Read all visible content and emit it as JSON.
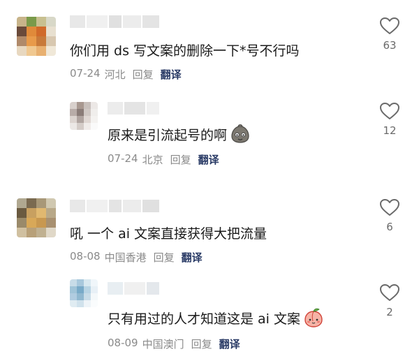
{
  "comments": [
    {
      "text": "你们用 ds 写文案的删除一下*号不行吗",
      "date": "07-24",
      "location": "河北",
      "reply_label": "回复",
      "translate_label": "翻译",
      "likes": "63",
      "avatar_colors": [
        "#c8b48a",
        "#7a9a4a",
        "#c8c090",
        "#d8d8c8",
        "#6a4a3a",
        "#e08a3a",
        "#d06a2a",
        "#e8e0d0",
        "#b08a6a",
        "#e89a4a",
        "#c87a3a",
        "#d8c8b0",
        "#e8d8c0",
        "#f0c890",
        "#e8b070",
        "#f0e8d8"
      ],
      "name_blur": [
        "#e8e8e8",
        "#f0f0f0",
        "#e0e0e0",
        "#ececec",
        "#e4e4e4"
      ]
    },
    {
      "text": "原来是引流起号的啊",
      "emoji": "dirt-face-emoji",
      "date": "07-24",
      "location": "北京",
      "reply_label": "回复",
      "translate_label": "翻译",
      "likes": "12",
      "avatar_colors": [
        "#d8d0cc",
        "#a89890",
        "#c8c0bc",
        "#ece8e6",
        "#b8aca8",
        "#8a7c78",
        "#d0c8c4",
        "#f0eeec",
        "#dcd4d0",
        "#b0a4a0",
        "#e0d8d4",
        "#f4f2f0",
        "#ece8e6",
        "#d4ccc8",
        "#f0ecea",
        "#fafafa"
      ],
      "name_blur": [
        "#ececec",
        "#e4e4e4",
        "#f0f0f0"
      ]
    },
    {
      "text": "吼 一个 ai 文案直接获得大把流量",
      "date": "08-08",
      "location": "中国香港",
      "reply_label": "回复",
      "translate_label": "翻译",
      "likes": "6",
      "avatar_colors": [
        "#b0a890",
        "#7a6a50",
        "#a89878",
        "#d0c8b0",
        "#6a5a40",
        "#c8a060",
        "#e0b870",
        "#b8a888",
        "#9a8a6a",
        "#d8a858",
        "#c89850",
        "#a89070",
        "#d0c0a0",
        "#b8a078",
        "#c0b090",
        "#e0d8c8"
      ],
      "name_blur": [
        "#e8e8e8",
        "#f0f0f0",
        "#e4e4e4",
        "#ececec",
        "#e0e0e0"
      ]
    },
    {
      "text": "只有用过的人才知道这是 ai 文案",
      "emoji": "peach-emoji",
      "date": "08-09",
      "location": "中国澳门",
      "reply_label": "回复",
      "translate_label": "翻译",
      "likes": "2",
      "avatar_colors": [
        "#c8dce8",
        "#a8c8dc",
        "#d8e8f0",
        "#f0f6fa",
        "#a0c4d8",
        "#78aac8",
        "#b8d4e4",
        "#e8f0f6",
        "#b0cce0",
        "#90b8d0",
        "#c8dce8",
        "#f4f8fa",
        "#e0ecf2",
        "#d0e2ec",
        "#eef4f8",
        "#fafcfd"
      ],
      "name_blur": [
        "#e8eef2",
        "#f0f0f0",
        "#e4e8ec"
      ]
    }
  ]
}
